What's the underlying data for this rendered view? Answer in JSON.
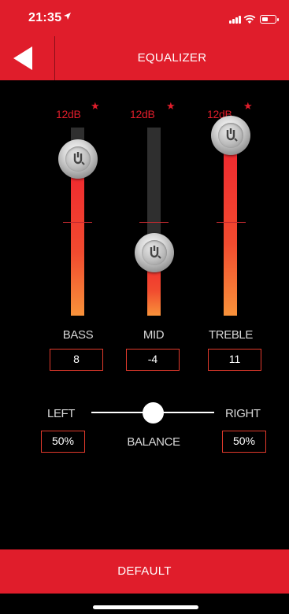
{
  "status_bar": {
    "time": "21:35"
  },
  "header": {
    "title": "EQUALIZER"
  },
  "equalizer": {
    "max_label": "12dB",
    "max_db": 12,
    "min_db": -12,
    "bands": [
      {
        "name": "BASS",
        "value": "8"
      },
      {
        "name": "MID",
        "value": "-4"
      },
      {
        "name": "TREBLE",
        "value": "11"
      }
    ]
  },
  "balance": {
    "left_label": "LEFT",
    "right_label": "RIGHT",
    "label": "BALANCE",
    "left_value": "50%",
    "right_value": "50%",
    "position": 0.5
  },
  "footer": {
    "default_label": "DEFAULT"
  },
  "colors": {
    "accent": "#e01d2b",
    "track": "#2f2f2f",
    "fill_bottom": "#f8923a"
  }
}
